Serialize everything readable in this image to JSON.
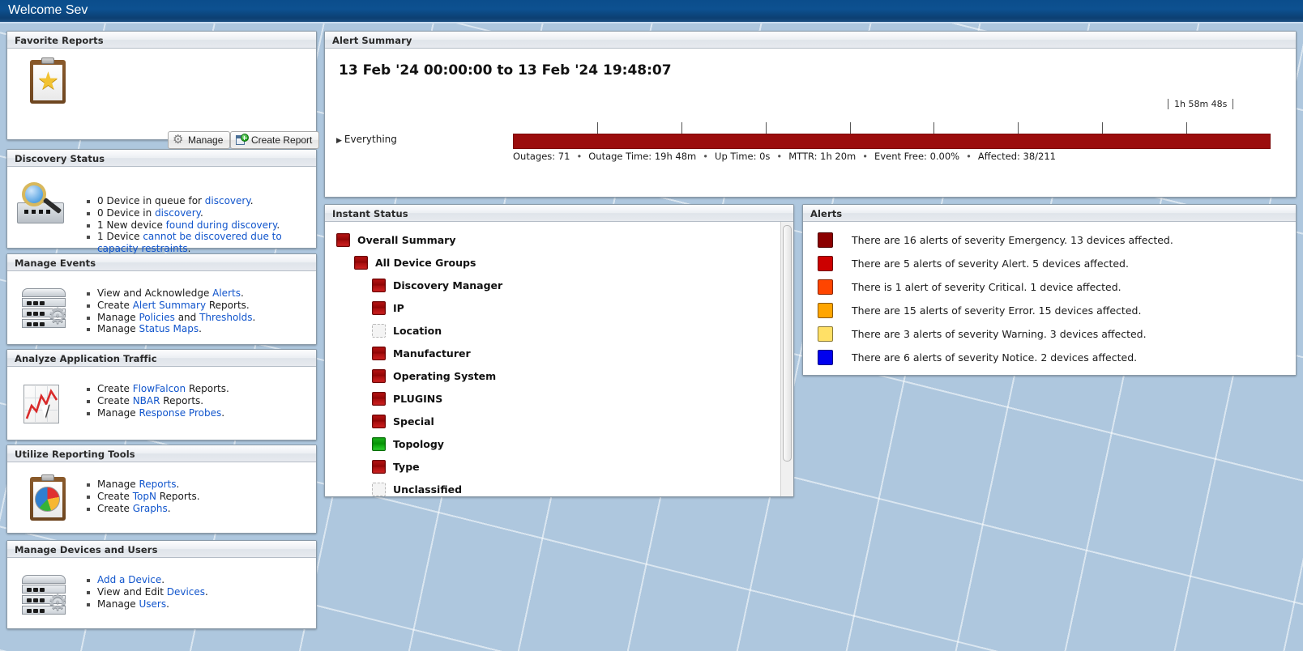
{
  "titlebar": {
    "title": "Welcome Sev"
  },
  "panels": {
    "favorite_reports": {
      "title": "Favorite Reports",
      "manage_label": "Manage",
      "create_report_label": "Create Report"
    },
    "discovery_status": {
      "title": "Discovery Status",
      "items": [
        {
          "pre": "0 Device in queue for ",
          "link": "discovery",
          "post": "."
        },
        {
          "pre": "0 Device in ",
          "link": "discovery",
          "post": "."
        },
        {
          "pre": "1 New device ",
          "link": "found during discovery",
          "post": "."
        },
        {
          "pre": "1 Device ",
          "link": "cannot be discovered due to capacity restraints",
          "post": "."
        }
      ]
    },
    "manage_events": {
      "title": "Manage Events",
      "items": [
        {
          "pre": "View and Acknowledge ",
          "link": "Alerts",
          "post": "."
        },
        {
          "pre": "Create ",
          "link": "Alert Summary",
          "post": " Reports."
        },
        {
          "pre": "Manage ",
          "link": "Policies",
          "mid": " and ",
          "link2": "Thresholds",
          "post": "."
        },
        {
          "pre": "Manage ",
          "link": "Status Maps",
          "post": "."
        }
      ]
    },
    "analyze_traffic": {
      "title": "Analyze Application Traffic",
      "items": [
        {
          "pre": "Create ",
          "link": "FlowFalcon",
          "post": " Reports."
        },
        {
          "pre": "Create ",
          "link": "NBAR",
          "post": " Reports."
        },
        {
          "pre": "Manage ",
          "link": "Response Probes",
          "post": "."
        }
      ]
    },
    "reporting_tools": {
      "title": "Utilize Reporting Tools",
      "items": [
        {
          "pre": "Manage ",
          "link": "Reports",
          "post": "."
        },
        {
          "pre": "Create ",
          "link": "TopN",
          "post": " Reports."
        },
        {
          "pre": "Create ",
          "link": "Graphs",
          "post": "."
        }
      ]
    },
    "devices_users": {
      "title": "Manage Devices and Users",
      "items": [
        {
          "pre": "",
          "link": "Add a Device",
          "post": "."
        },
        {
          "pre": "View and Edit ",
          "link": "Devices",
          "post": "."
        },
        {
          "pre": "Manage ",
          "link": "Users",
          "post": "."
        }
      ]
    },
    "alert_summary": {
      "title": "Alert Summary",
      "range": "13 Feb '24 00:00:00 to 13 Feb '24 19:48:07",
      "group_label": "Everything",
      "scale_label": "1h 58m 48s",
      "bar_color": "#9b0d0d",
      "tick_count": 8,
      "stats": [
        "Outages: 71",
        "Outage Time: 19h 48m",
        "Up Time: 0s",
        "MTTR: 1h 20m",
        "Event Free: 0.00%",
        "Affected: 38/211"
      ]
    },
    "instant_status": {
      "title": "Instant Status",
      "rows": [
        {
          "label": "Overall Summary",
          "state": "red",
          "indent": 0
        },
        {
          "label": "All Device Groups",
          "state": "red",
          "indent": 1
        },
        {
          "label": "Discovery Manager",
          "state": "red",
          "indent": 2
        },
        {
          "label": "IP",
          "state": "red",
          "indent": 2
        },
        {
          "label": "Location",
          "state": "empty",
          "indent": 2
        },
        {
          "label": "Manufacturer",
          "state": "red",
          "indent": 2
        },
        {
          "label": "Operating System",
          "state": "red",
          "indent": 2
        },
        {
          "label": "PLUGINS",
          "state": "red",
          "indent": 2
        },
        {
          "label": "Special",
          "state": "red",
          "indent": 2
        },
        {
          "label": "Topology",
          "state": "green",
          "indent": 2
        },
        {
          "label": "Type",
          "state": "red",
          "indent": 2
        },
        {
          "label": "Unclassified",
          "state": "empty",
          "indent": 2
        }
      ]
    },
    "alerts": {
      "title": "Alerts",
      "rows": [
        {
          "severity": "Emergency",
          "color": "#8b0000",
          "text": "There are 16 alerts of severity Emergency. 13 devices affected."
        },
        {
          "severity": "Alert",
          "color": "#cc0000",
          "text": "There are 5 alerts of severity Alert. 5 devices affected."
        },
        {
          "severity": "Critical",
          "color": "#ff4500",
          "text": "There is 1 alert of severity Critical. 1 device affected."
        },
        {
          "severity": "Error",
          "color": "#ffa500",
          "text": "There are 15 alerts of severity Error. 15 devices affected."
        },
        {
          "severity": "Warning",
          "color": "#ffe066",
          "text": "There are 3 alerts of severity Warning. 3 devices affected."
        },
        {
          "severity": "Notice",
          "color": "#0000ee",
          "text": "There are 6 alerts of severity Notice. 2 devices affected."
        }
      ]
    }
  },
  "colors": {
    "header_blue": "#0d5190",
    "desktop_blue": "#aec7de",
    "link_blue": "#1155cc"
  }
}
